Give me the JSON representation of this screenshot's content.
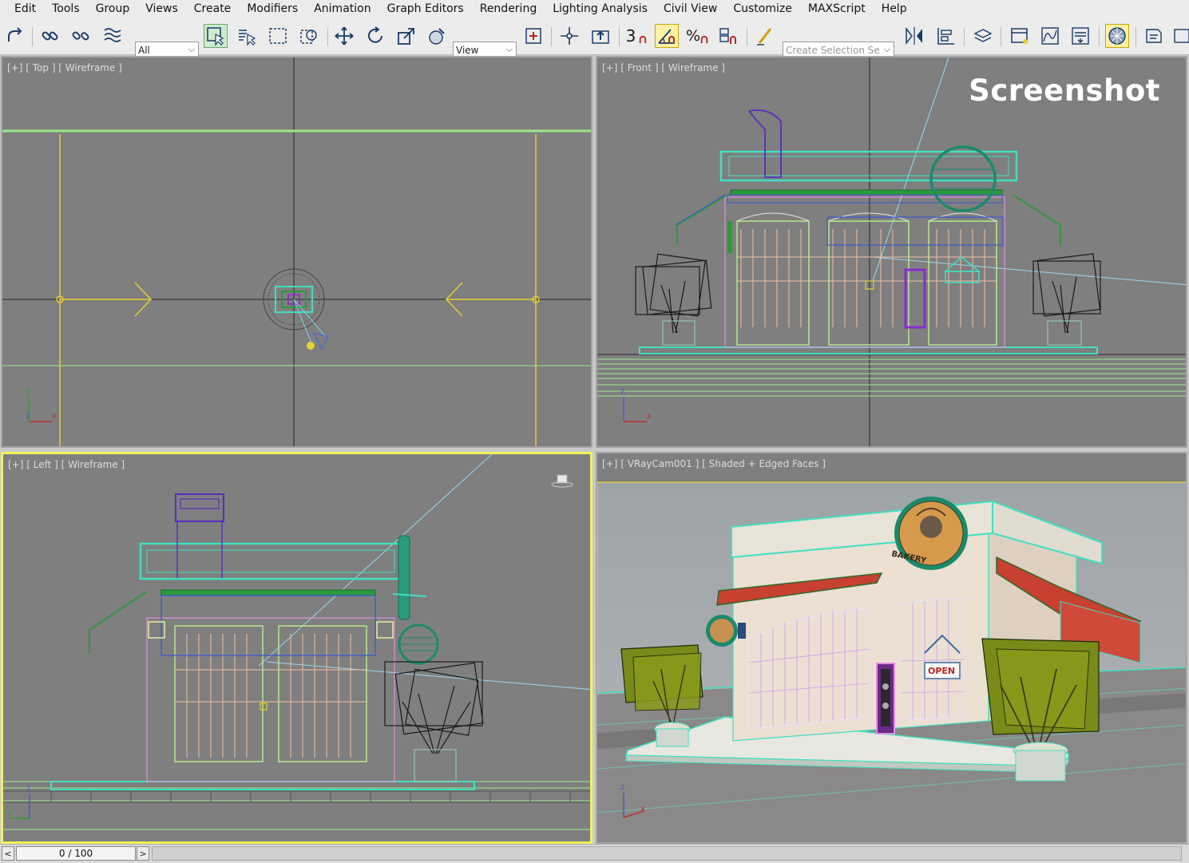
{
  "menu": [
    "Edit",
    "Tools",
    "Group",
    "Views",
    "Create",
    "Modifiers",
    "Animation",
    "Graph Editors",
    "Rendering",
    "Lighting Analysis",
    "Civil View",
    "Customize",
    "MAXScript",
    "Help"
  ],
  "toolbar": {
    "selection_filter": "All",
    "reference_coord": "View",
    "snap_label": "3",
    "named_selection_placeholder": "Create Selection Se",
    "icons": [
      "undo-icon",
      "link-icon",
      "unlink-icon",
      "bind-spacewarp-icon",
      "select-object-icon",
      "select-by-name-icon",
      "rect-region-icon",
      "window-crossing-icon",
      "move-icon",
      "rotate-icon",
      "scale-icon",
      "placement-icon",
      "select-manipulate-icon",
      "pivot-icon",
      "keyboard-shortcut-icon",
      "snaps-toggle-icon",
      "angle-snap-icon",
      "percent-snap-icon",
      "spinner-snap-icon",
      "edit-named-sel-icon",
      "mirror-icon",
      "align-icon",
      "layer-manager-icon",
      "scene-explorer-icon",
      "curve-editor-icon",
      "schematic-view-icon",
      "material-editor-icon",
      "render-setup-icon",
      "render-frame-icon"
    ]
  },
  "viewports": {
    "top": {
      "label": "[+] [ Top ] [ Wireframe ]"
    },
    "front": {
      "label": "[+] [ Front ] [ Wireframe ]"
    },
    "left": {
      "label": "[+] [ Left ] [ Wireframe ]"
    },
    "camera": {
      "label": "[+] [ VRayCam001 ] [ Shaded + Edged Faces ]"
    },
    "watermark": "Screenshot",
    "axis_labels": {
      "x": "x",
      "y": "y",
      "z": "z"
    }
  },
  "scene_text": {
    "sign": "BAKERY",
    "door_sign": "OPEN"
  },
  "timeslider": {
    "prev": "<",
    "frame": "0 / 100",
    "next": ">"
  },
  "colors": {
    "accent_active": "#f3f05a",
    "viewport_bg": "#7f7f7f",
    "wire_cyan": "#3fe0c0",
    "wire_yellow": "#e8d230",
    "wire_purple": "#8a2bd0"
  }
}
